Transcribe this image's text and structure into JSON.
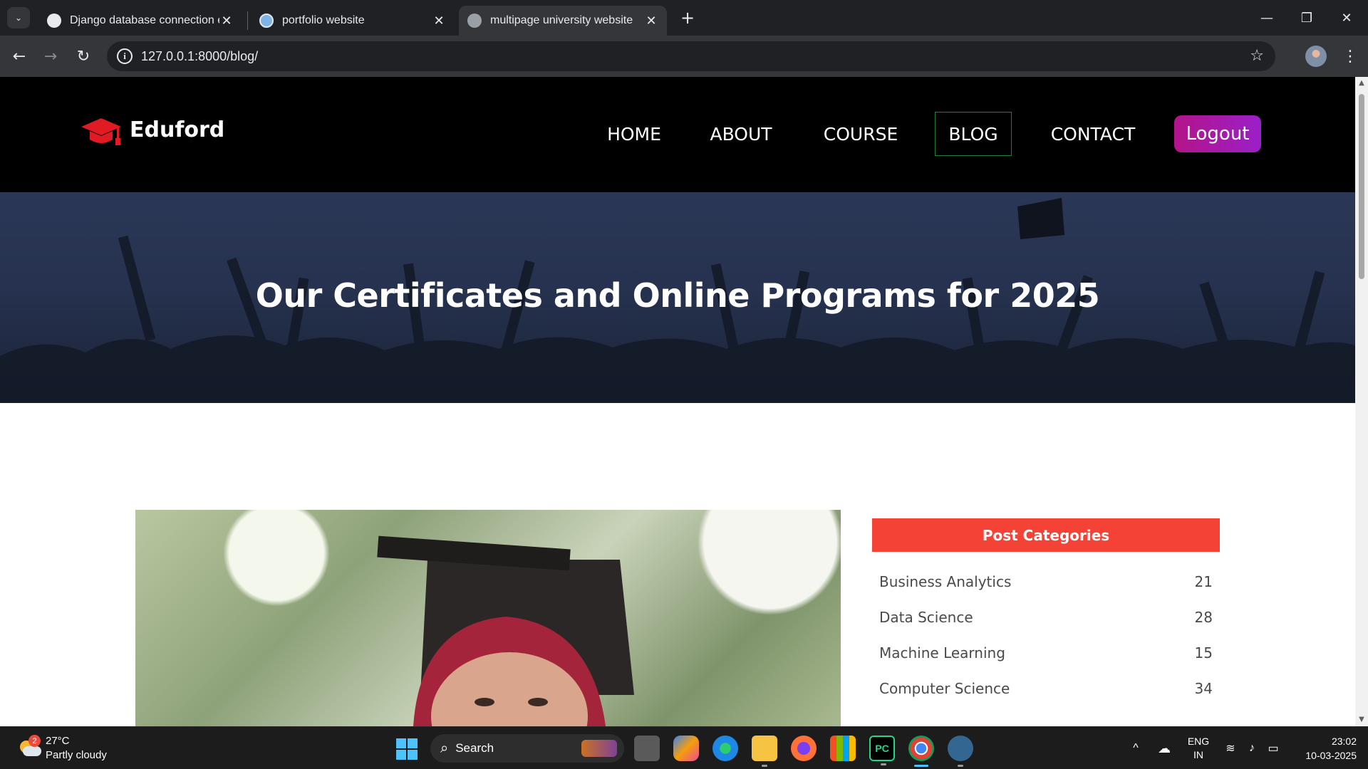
{
  "browser": {
    "tabs": [
      {
        "title": "Django database connection er",
        "favicon": "chatgpt-icon",
        "active": false
      },
      {
        "title": "portfolio website",
        "favicon": "site-icon",
        "active": false
      },
      {
        "title": "multipage university website",
        "favicon": "globe-icon",
        "active": true
      }
    ],
    "url": "127.0.0.1:8000/blog/"
  },
  "site": {
    "brand": "Eduford",
    "nav": [
      "HOME",
      "ABOUT",
      "COURSE",
      "BLOG",
      "CONTACT"
    ],
    "active_nav": "BLOG",
    "logout": "Logout",
    "hero_title": "Our Certificates and Online Programs for 2025",
    "colors": {
      "accent": "#f44336",
      "logout_start": "#b3148a",
      "logout_end": "#9b1fc8",
      "header_bg": "#000000"
    }
  },
  "sidebar": {
    "title": "Post Categories",
    "categories": [
      {
        "name": "Business Analytics",
        "count": "21"
      },
      {
        "name": "Data Science",
        "count": "28"
      },
      {
        "name": "Machine Learning",
        "count": "15"
      },
      {
        "name": "Computer Science",
        "count": "34"
      }
    ]
  },
  "taskbar": {
    "weather": {
      "temp": "27°C",
      "condition": "Partly cloudy",
      "badge": "2"
    },
    "search_placeholder": "Search",
    "language": {
      "line1": "ENG",
      "line2": "IN"
    },
    "time": "23:02",
    "date": "10-03-2025",
    "apps": [
      "task-view-icon",
      "copilot-icon",
      "edge-icon",
      "file-explorer-icon",
      "firefox-icon",
      "microsoft-store-icon",
      "pycharm-icon",
      "chrome-icon",
      "postgresql-icon"
    ]
  }
}
